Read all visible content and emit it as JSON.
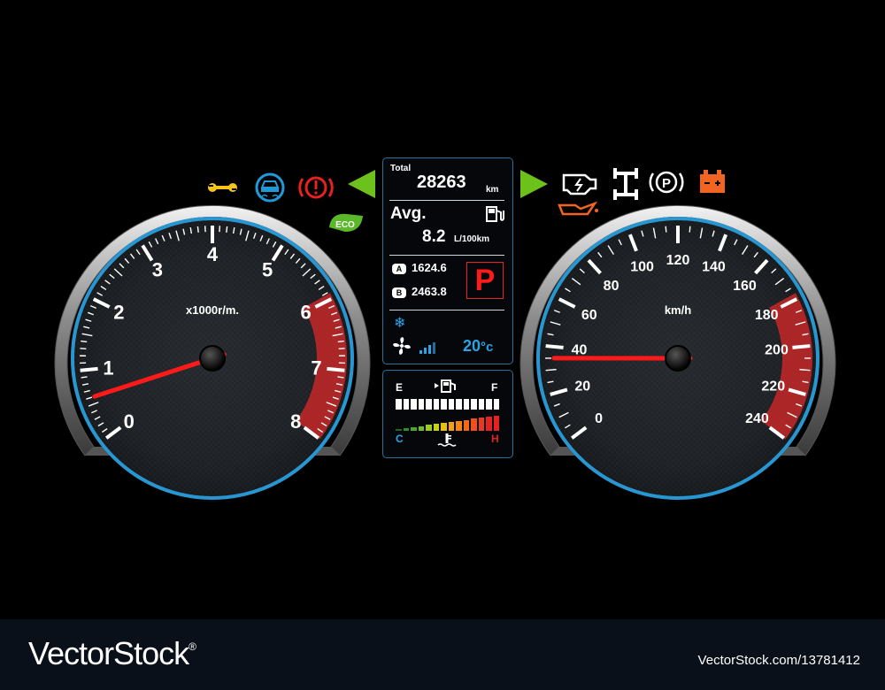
{
  "tachometer": {
    "labels": [
      "0",
      "1",
      "2",
      "3",
      "4",
      "5",
      "6",
      "7",
      "8"
    ],
    "unit": "x1000r/m.",
    "needle_value": 0.6,
    "max": 8
  },
  "speedometer": {
    "labels": [
      "0",
      "20",
      "40",
      "60",
      "80",
      "100",
      "120",
      "140",
      "160",
      "180",
      "200",
      "220",
      "240"
    ],
    "unit": "km/h",
    "needle_value": 35,
    "max": 240
  },
  "info_panel": {
    "total_label": "Total",
    "total_value": "28263",
    "total_unit": "km",
    "avg_label": "Avg.",
    "avg_value": "8.2",
    "avg_unit": "L/100km",
    "trip_a_letter": "A",
    "trip_a_value": "1624.6",
    "trip_b_letter": "B",
    "trip_b_value": "2463.8",
    "gear": "P",
    "temperature": "20",
    "temperature_unit": "°c",
    "fan_level": 3
  },
  "gauges_panel": {
    "fuel_empty": "E",
    "fuel_full": "F",
    "fuel_level_fraction": 1.0,
    "temp_cold": "C",
    "temp_hot": "H"
  },
  "warning_icons_left": [
    "wrench-icon",
    "traction-control-icon",
    "brake-warning-icon",
    "eco-icon"
  ],
  "warning_icons_right": [
    "check-engine-icon",
    "oil-pressure-icon",
    "axle-icon",
    "parking-brake-icon",
    "battery-icon"
  ],
  "eco_label": "ECO",
  "colors": {
    "accent_blue": "#2aa4e4",
    "needle_red": "#ff1a1a",
    "redline": "#c62828",
    "turn_signal": "#6cc11b",
    "warning_red": "#e52222",
    "warning_orange": "#f26422",
    "lcd_border": "#2f6f98"
  },
  "footer": {
    "brand": "VectorStock",
    "brand_mark": "®",
    "image_id": "VectorStock.com/13781412"
  }
}
